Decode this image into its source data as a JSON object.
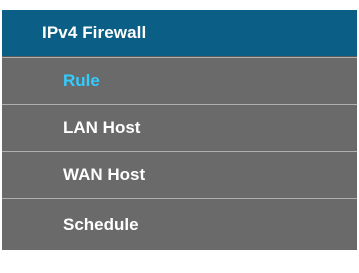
{
  "menu": {
    "header": {
      "label": "IPv4 Firewall"
    },
    "items": [
      {
        "label": "Rule",
        "active": true
      },
      {
        "label": "LAN Host",
        "active": false
      },
      {
        "label": "WAN Host",
        "active": false
      },
      {
        "label": "Schedule",
        "active": false
      }
    ]
  },
  "colors": {
    "header_bg": "#0b5f86",
    "item_bg": "#6a6a6a",
    "active_text": "#33ccff",
    "text": "#ffffff"
  }
}
